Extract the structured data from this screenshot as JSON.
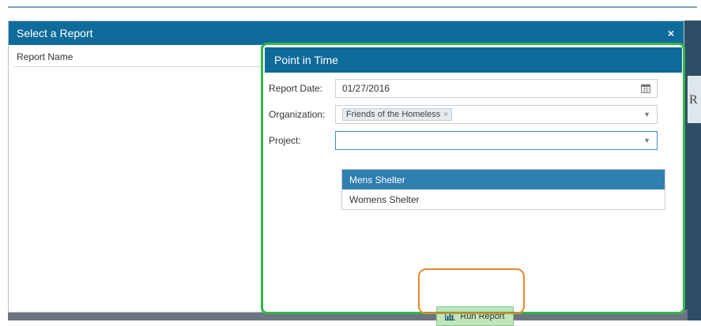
{
  "modal": {
    "title": "Select a Report",
    "close_label": "×"
  },
  "left_panel": {
    "column_header": "Report Name"
  },
  "report_panel": {
    "title": "Point in Time",
    "report_date": {
      "label": "Report Date:",
      "value": "01/27/2016"
    },
    "organization": {
      "label": "Organization:",
      "selected_tag": "Friends of the Homeless",
      "tag_remove": "×"
    },
    "project": {
      "label": "Project:",
      "value": "",
      "options": [
        {
          "label": "Mens Shelter",
          "selected": true
        },
        {
          "label": "Womens Shelter",
          "selected": false
        }
      ]
    },
    "run_button": {
      "label": "Run Report",
      "icon": "bar-chart-icon"
    }
  },
  "icons": {
    "date": "calendar-icon",
    "dropdown": "chevron-down-icon",
    "close": "close-icon"
  },
  "colors": {
    "header_blue": "#0f6b9a",
    "selected_option": "#2f7fb1",
    "run_button_bg": "#bfe6bd",
    "annotation_green": "#35b44a",
    "annotation_orange": "#ef8532"
  },
  "background": {
    "right_glyph": "R"
  }
}
